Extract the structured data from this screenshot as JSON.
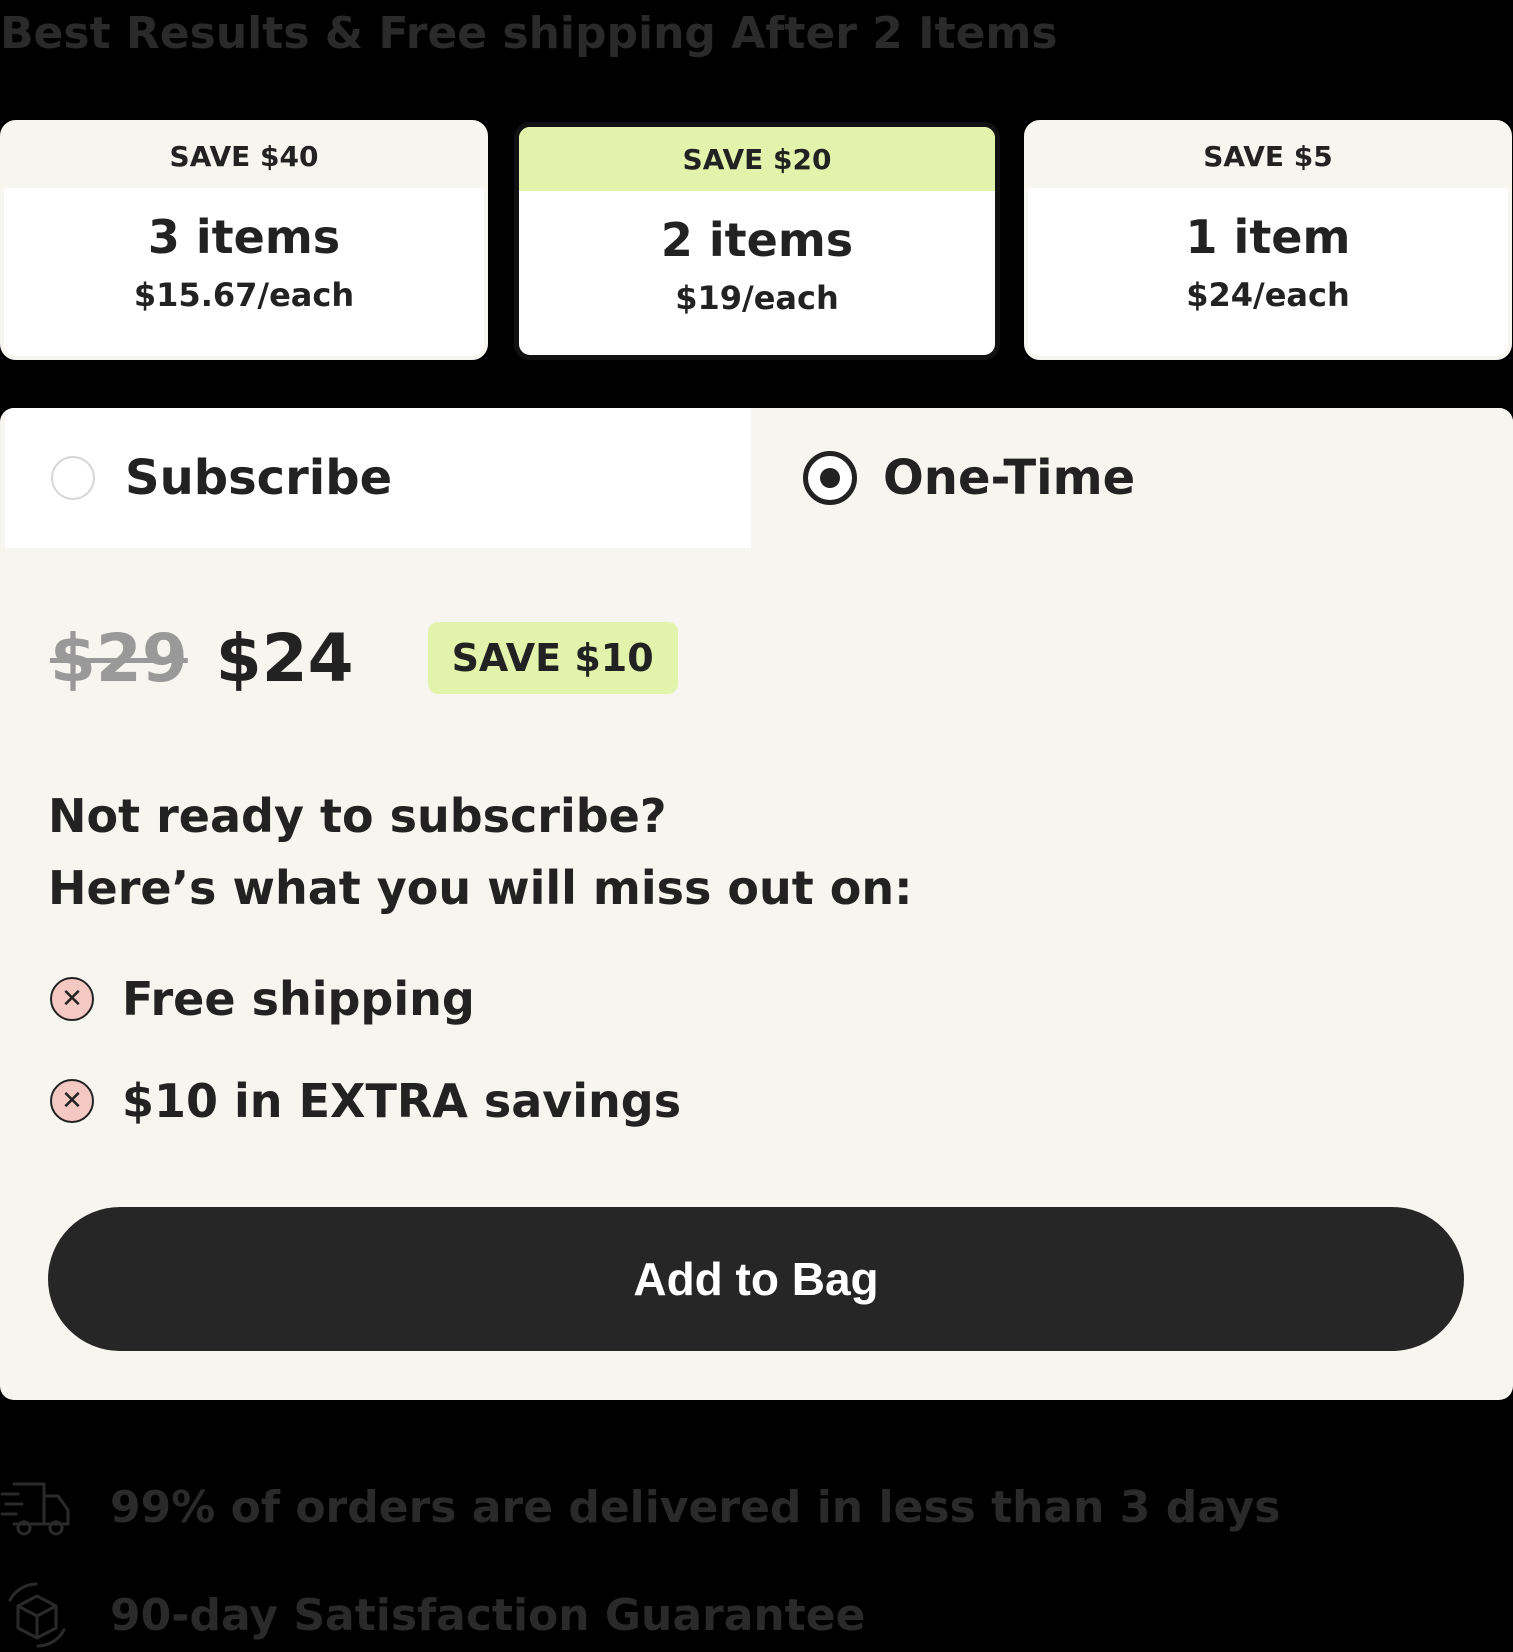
{
  "headline": "Best Results & Free shipping After 2 Items",
  "tiers": [
    {
      "save": "SAVE $40",
      "qty": "3 items",
      "price": "$15.67/each",
      "selected": false
    },
    {
      "save": "SAVE $20",
      "qty": "2 items",
      "price": "$19/each",
      "selected": true
    },
    {
      "save": "SAVE $5",
      "qty": "1 item",
      "price": "$24/each",
      "selected": false
    }
  ],
  "purchase_options": {
    "subscribe_label": "Subscribe",
    "one_time_label": "One-Time",
    "selected": "One-Time"
  },
  "pricing": {
    "old_price": "$29",
    "new_price": "$24",
    "save_badge": "SAVE $10"
  },
  "miss_out": {
    "line1": "Not ready to subscribe?",
    "line2": "Here’s what you will miss out on:",
    "items": [
      "Free shipping",
      "$10 in EXTRA savings"
    ],
    "icon": "x-circle-icon"
  },
  "cta": {
    "label": "Add to Bag"
  },
  "perks": [
    {
      "icon": "delivery-truck-icon",
      "text": "99% of orders are delivered in less than 3 days"
    },
    {
      "icon": "guarantee-box-icon",
      "text": "90-day Satisfaction Guarantee"
    }
  ],
  "colors": {
    "accent": "#e4f3ab",
    "panel_bg": "#f7f5f0",
    "button": "#262626",
    "x_icon_bg": "#f4c9c3"
  }
}
